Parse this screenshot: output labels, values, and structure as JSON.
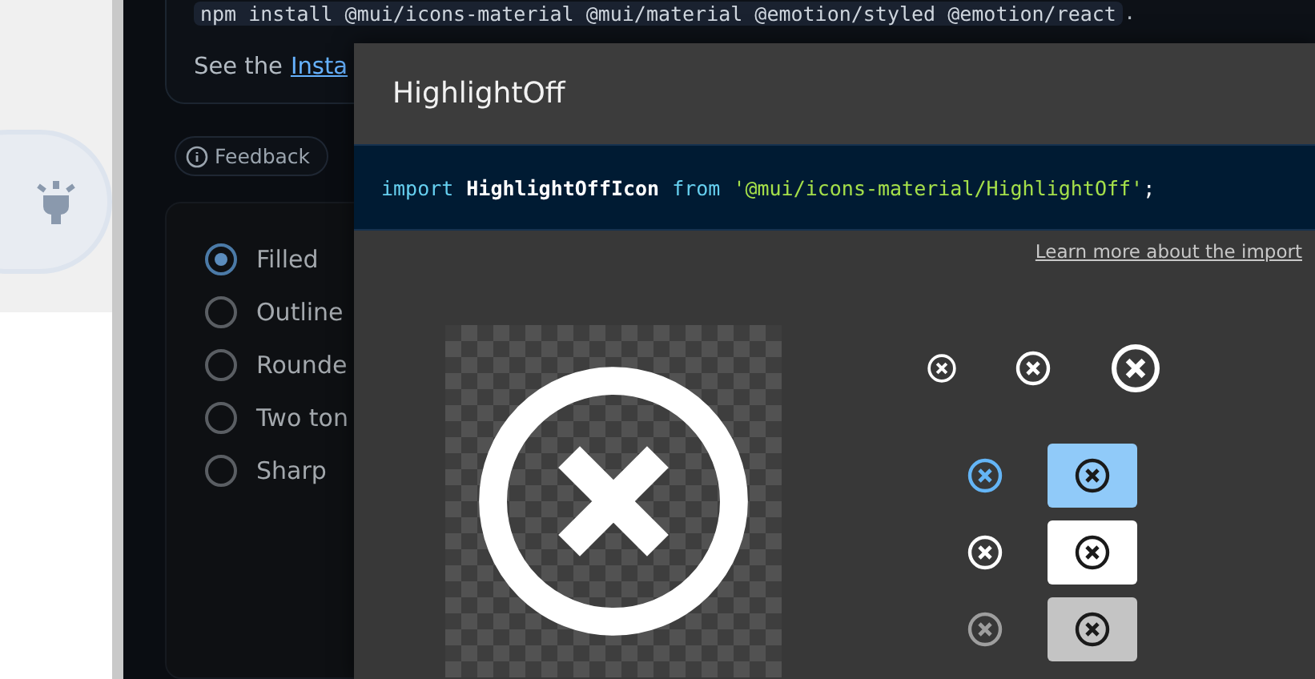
{
  "install_command": "npm install @mui/icons-material @mui/material @emotion/styled @emotion/react",
  "install_period": ".",
  "see_text": "See the",
  "see_link": "Insta",
  "feedback_button": "Feedback",
  "theme_options": [
    {
      "label": "Filled",
      "selected": true
    },
    {
      "label": "Outline",
      "selected": false
    },
    {
      "label": "Rounde",
      "selected": false
    },
    {
      "label": "Two ton",
      "selected": false
    },
    {
      "label": "Sharp",
      "selected": false
    }
  ],
  "dialog": {
    "title": "HighlightOff",
    "import_code": [
      {
        "kind": "keyword",
        "text": "import"
      },
      {
        "kind": "name",
        "text": "HighlightOffIcon"
      },
      {
        "kind": "keyword",
        "text": "from"
      },
      {
        "kind": "string",
        "text": "'@mui/icons-material/HighlightOff'"
      },
      {
        "kind": "punct",
        "text": ";"
      }
    ],
    "learn_link": "Learn more about the import",
    "color_previews": [
      {
        "icon": {
          "color": "#64b5f6"
        },
        "swatch": {
          "color": "#90caf9"
        }
      },
      {
        "icon": {
          "color": "#ffffff"
        },
        "swatch": {
          "color": "#ffffff"
        }
      },
      {
        "icon": {
          "color": "#9e9e9e"
        },
        "swatch": {
          "color": "#c4c4c4"
        }
      }
    ]
  }
}
